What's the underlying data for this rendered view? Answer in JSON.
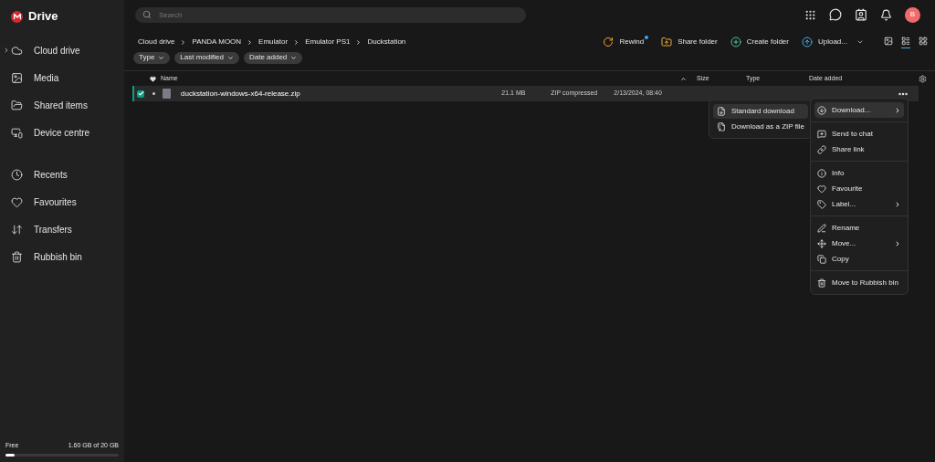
{
  "app": {
    "name": "Drive"
  },
  "sidebar": {
    "groups": [
      [
        {
          "label": "Cloud drive",
          "kind": "cloud",
          "collapsible": true
        },
        {
          "label": "Media",
          "kind": "image",
          "collapsible": false
        },
        {
          "label": "Shared items",
          "kind": "shared",
          "collapsible": false
        },
        {
          "label": "Device centre",
          "kind": "devices",
          "collapsible": false
        }
      ],
      [
        {
          "label": "Recents",
          "kind": "clock",
          "collapsible": false
        },
        {
          "label": "Favourites",
          "kind": "heart",
          "collapsible": false
        },
        {
          "label": "Transfers",
          "kind": "transfers",
          "collapsible": false
        },
        {
          "label": "Rubbish bin",
          "kind": "trash",
          "collapsible": false
        }
      ]
    ],
    "storage": {
      "label": "Free",
      "reading": "1.60 GB of 20 GB",
      "level": 0.08
    }
  },
  "search": {
    "placeholder": "Search"
  },
  "avatar": {
    "initial": "B"
  },
  "breadcrumbs": [
    "Cloud drive",
    "PANDA MOON",
    "Emulator",
    "Emulator PS1",
    "Duckstation"
  ],
  "actions": [
    {
      "label": "Rewind",
      "kind": "rewind",
      "notification": true
    },
    {
      "label": "Share folder",
      "kind": "share",
      "notification": false
    },
    {
      "label": "Create folder",
      "kind": "create",
      "notification": false
    },
    {
      "label": "Upload...",
      "kind": "upload",
      "notification": false
    }
  ],
  "views": [
    {
      "kind": "gallery",
      "selected": false
    },
    {
      "kind": "list",
      "selected": true
    },
    {
      "kind": "grid",
      "selected": false
    }
  ],
  "filters": [
    "Type",
    "Last modified",
    "Date added"
  ],
  "table": {
    "columns": [
      "Name",
      "Size",
      "Type",
      "Date added"
    ],
    "rows": [
      {
        "name": "duckstation-windows-x64-release.zip",
        "size": "21.1 MB",
        "type": "ZIP compressed",
        "date": "2/13/2024, 08:40",
        "selected": true
      }
    ]
  },
  "context_menu": {
    "groups": [
      [
        {
          "label": "Download...",
          "kind": "download",
          "submenu": true,
          "highlighted": true
        }
      ],
      [
        {
          "label": "Send to chat",
          "kind": "chat",
          "submenu": false,
          "highlighted": false
        },
        {
          "label": "Share link",
          "kind": "link",
          "submenu": false,
          "highlighted": false
        }
      ],
      [
        {
          "label": "Info",
          "kind": "info",
          "submenu": false,
          "highlighted": false
        },
        {
          "label": "Favourite",
          "kind": "heart",
          "submenu": false,
          "highlighted": false
        },
        {
          "label": "Label...",
          "kind": "tag",
          "submenu": true,
          "highlighted": false
        }
      ],
      [
        {
          "label": "Rename",
          "kind": "pen",
          "submenu": false,
          "highlighted": false
        },
        {
          "label": "Move...",
          "kind": "move",
          "submenu": true,
          "highlighted": false
        },
        {
          "label": "Copy",
          "kind": "copy",
          "submenu": false,
          "highlighted": false
        }
      ],
      [
        {
          "label": "Move to Rubbish bin",
          "kind": "trash",
          "submenu": false,
          "highlighted": false
        }
      ]
    ],
    "submenu": [
      {
        "label": "Standard download",
        "kind": "download-box",
        "highlighted": true
      },
      {
        "label": "Download as a ZIP file",
        "kind": "zip",
        "highlighted": false
      }
    ]
  }
}
